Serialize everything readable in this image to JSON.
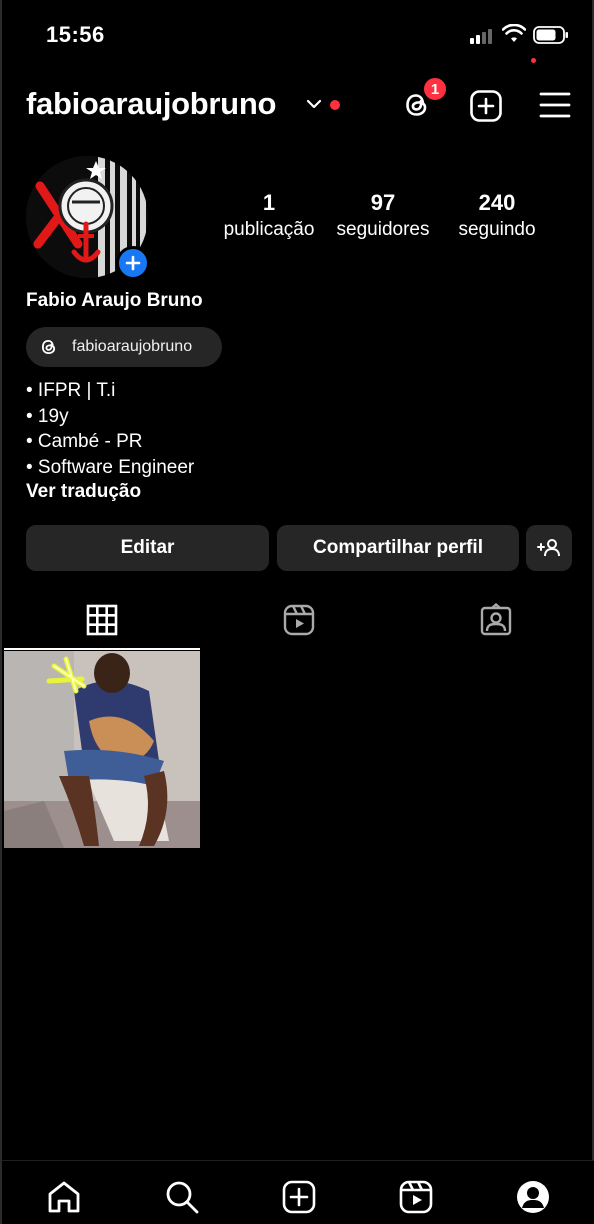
{
  "status_bar": {
    "time": "15:56"
  },
  "header": {
    "username": "fabioaraujobruno",
    "notification_count": "1"
  },
  "profile": {
    "stats": [
      {
        "value": "1",
        "label": "publicação"
      },
      {
        "value": "97",
        "label": "seguidores"
      },
      {
        "value": "240",
        "label": "seguindo"
      }
    ],
    "full_name": "Fabio Araujo Bruno",
    "threads_handle": "fabioaraujobruno",
    "bio_lines": [
      "• IFPR | T.i",
      "• 19y",
      "• Cambé - PR",
      "• Software Engineer"
    ],
    "see_translation": "Ver tradução"
  },
  "actions": {
    "edit_label": "Editar",
    "share_label": "Compartilhar perfil"
  },
  "tabs": [
    "grid-icon",
    "reels-icon",
    "tagged-icon"
  ],
  "bottom_nav": [
    "home-icon",
    "search-icon",
    "create-icon",
    "reels-icon",
    "profile-icon"
  ],
  "colors": {
    "background": "#000000",
    "button": "#262626",
    "accent_red": "#ff3040",
    "accent_blue": "#1877f2"
  }
}
